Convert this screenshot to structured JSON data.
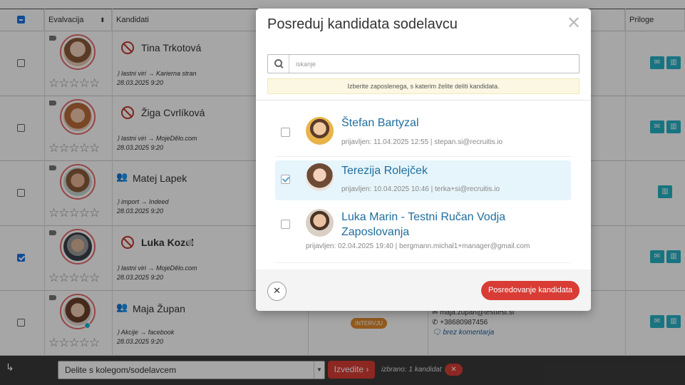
{
  "table": {
    "columns": [
      "Evalvacija",
      "Kandidati",
      "Priloge"
    ],
    "rows": [
      {
        "name": "Tina Trkotová",
        "source": "lastni viri → Karierna stran",
        "date": "28.03.2025 9:20",
        "checked": false,
        "rating": "☆☆☆☆☆"
      },
      {
        "name": "Žiga Cvrlíková",
        "source": "lastni viri → MojeDělo.com",
        "date": "28.03.2025 9:20",
        "checked": false,
        "rating": "☆☆☆☆☆"
      },
      {
        "name": "Matej Lapek",
        "source": "import → Indeed",
        "date": "28.03.2025 9:20",
        "checked": false,
        "rating": "☆☆☆☆☆"
      },
      {
        "name": "Luka Kozel",
        "source": "lastni viri → MojeDělo.com",
        "date": "28.03.2025 9:20",
        "checked": true,
        "rating": "☆☆☆☆☆"
      },
      {
        "name": "Maja Župan",
        "source": "Akcije → facebook",
        "date": "28.03.2025 9:20",
        "checked": false,
        "rating": "☆☆☆☆☆",
        "stage": "INTERVJU",
        "email": "maja.zupan@testtest.si",
        "phone": "+38680987456",
        "comment": "brez komentarja"
      }
    ]
  },
  "bottom": {
    "action_select": "Delite s kolegom/sodelavcem",
    "execute_label": "Izvedite ›",
    "selected": "izbrano: 1 kandidat",
    "clear_label": "✕"
  },
  "modal": {
    "title": "Posreduj kandidata sodelavcu",
    "search_placeholder": "iskanje",
    "notice": "Izberite zaposlenega, s katerim želite deliti kandidata.",
    "colleagues": [
      {
        "name": "Štefan Bartyzal",
        "meta": "prijavljen: 11.04.2025 12:55 | stepan.si@recruitis.io",
        "selected": false
      },
      {
        "name": "Terezija Rolejček",
        "meta": "prijavljen: 10.04.2025 10:46 | terka+si@recruitis.io",
        "selected": true
      },
      {
        "name": "Luka Marin - Testni Ručan Vodja Zaposlovanja",
        "meta": "prijavljen: 02.04.2025 19:40 | bergmann.michal1+manager@gmail.com",
        "selected": false
      }
    ],
    "cancel_label": "✕",
    "submit_label": "Posredovanje kandidata"
  },
  "colors": {
    "accent": "#d93c35",
    "link": "#1f6d9e",
    "teal": "#27b3c6",
    "selection": "#e6f5fb"
  }
}
